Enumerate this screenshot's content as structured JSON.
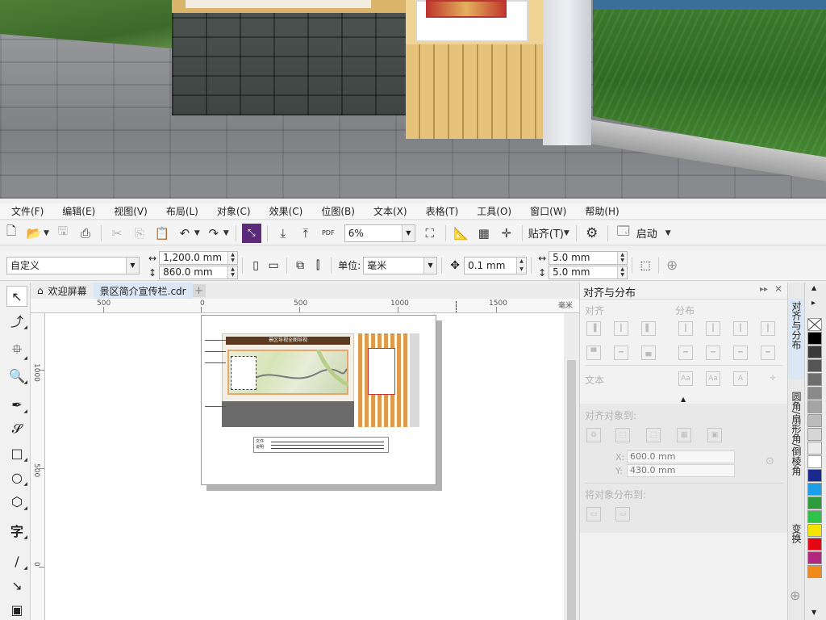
{
  "menubar": {
    "items": [
      "文件(F)",
      "编辑(E)",
      "视图(V)",
      "布局(L)",
      "对象(C)",
      "效果(C)",
      "位图(B)",
      "文本(X)",
      "表格(T)",
      "工具(O)",
      "窗口(W)",
      "帮助(H)"
    ]
  },
  "toolbar": {
    "zoom_value": "6%",
    "snap_label": "贴齐(T)",
    "launch_label": "启动"
  },
  "propbar": {
    "page_preset": "自定义",
    "width_value": "1,200.0 mm",
    "height_value": "860.0 mm",
    "unit_label": "单位:",
    "unit_value": "毫米",
    "nudge_value": "0.1 mm",
    "dup_x_value": "5.0 mm",
    "dup_y_value": "5.0 mm"
  },
  "tabs": {
    "welcome": "欢迎屏幕",
    "document": "景区简介宣传栏.cdr",
    "add": "+"
  },
  "ruler": {
    "h_labels": [
      "500",
      "0",
      "500",
      "1000",
      "1500",
      "毫米"
    ],
    "v_labels": [
      "1000",
      "500",
      "0"
    ]
  },
  "document": {
    "header_text": "景区导视全图导视",
    "note_label_1": "文件",
    "note_label_2": "说明"
  },
  "docker": {
    "title": "对齐与分布",
    "align_label": "对齐",
    "distribute_label": "分布",
    "text_label": "文本",
    "align_to_label": "对齐对象到:",
    "x_value": "600.0 mm",
    "y_value": "430.0 mm",
    "x_axis": "X:",
    "y_axis": "Y:",
    "distribute_to_label": "将对象分布到:"
  },
  "side_tabs": {
    "align_tab": "对齐与分布",
    "fillet_tab": "圆角/扇形角/倒棱角",
    "transform_tab": "变换"
  },
  "palette": {
    "colors": [
      "#ffffff",
      "#000000",
      "#3a3a3a",
      "#555555",
      "#6e6e6e",
      "#898989",
      "#a4a4a4",
      "#bcbcbc",
      "#d6d6d6",
      "#ececec",
      "#ffffff",
      "#1a2a8c",
      "#19a0e6",
      "#2d9b3a",
      "#2fc24a",
      "#f3e500",
      "#e30613",
      "#b0287e",
      "#f08a1c"
    ]
  },
  "colors": {
    "accent_tab": "#dbe7f4",
    "header_bar": "#5b3a1f",
    "wood": "#e09a4c",
    "dark_band": "#6b6b6b"
  }
}
